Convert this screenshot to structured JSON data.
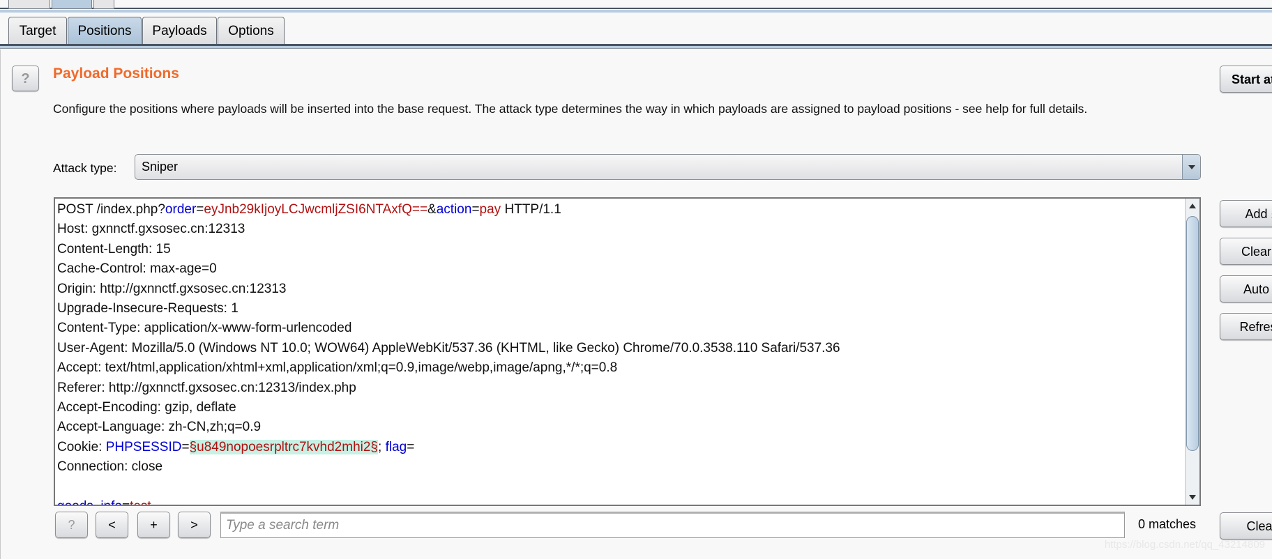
{
  "tabs": [
    {
      "label": "Target",
      "active": false
    },
    {
      "label": "Positions",
      "active": true
    },
    {
      "label": "Payloads",
      "active": false
    },
    {
      "label": "Options",
      "active": false
    }
  ],
  "section": {
    "help_label": "?",
    "title": "Payload Positions",
    "description": "Configure the positions where payloads will be inserted into the base request. The attack type determines the way in which payloads are assigned to payload positions - see help for full details."
  },
  "attack_type": {
    "label": "Attack type:",
    "value": "Sniper"
  },
  "request_lines": [
    [
      {
        "t": "plain",
        "s": "POST /index.php?"
      },
      {
        "t": "name",
        "s": "order"
      },
      {
        "t": "plain",
        "s": "="
      },
      {
        "t": "value",
        "s": "eyJnb29kIjoyLCJwcmljZSI6NTAxfQ=="
      },
      {
        "t": "plain",
        "s": "&"
      },
      {
        "t": "name",
        "s": "action"
      },
      {
        "t": "plain",
        "s": "="
      },
      {
        "t": "value",
        "s": "pay"
      },
      {
        "t": "plain",
        "s": " HTTP/1.1"
      }
    ],
    [
      {
        "t": "plain",
        "s": "Host: gxnnctf.gxsosec.cn:12313"
      }
    ],
    [
      {
        "t": "plain",
        "s": "Content-Length: 15"
      }
    ],
    [
      {
        "t": "plain",
        "s": "Cache-Control: max-age=0"
      }
    ],
    [
      {
        "t": "plain",
        "s": "Origin: http://gxnnctf.gxsosec.cn:12313"
      }
    ],
    [
      {
        "t": "plain",
        "s": "Upgrade-Insecure-Requests: 1"
      }
    ],
    [
      {
        "t": "plain",
        "s": "Content-Type: application/x-www-form-urlencoded"
      }
    ],
    [
      {
        "t": "plain",
        "s": "User-Agent: Mozilla/5.0 (Windows NT 10.0; WOW64) AppleWebKit/537.36 (KHTML, like Gecko) Chrome/70.0.3538.110 Safari/537.36"
      }
    ],
    [
      {
        "t": "plain",
        "s": "Accept: text/html,application/xhtml+xml,application/xml;q=0.9,image/webp,image/apng,*/*;q=0.8"
      }
    ],
    [
      {
        "t": "plain",
        "s": "Referer: http://gxnnctf.gxsosec.cn:12313/index.php"
      }
    ],
    [
      {
        "t": "plain",
        "s": "Accept-Encoding: gzip, deflate"
      }
    ],
    [
      {
        "t": "plain",
        "s": "Accept-Language: zh-CN,zh;q=0.9"
      }
    ],
    [
      {
        "t": "plain",
        "s": "Cookie: "
      },
      {
        "t": "name",
        "s": "PHPSESSID"
      },
      {
        "t": "plain",
        "s": "="
      },
      {
        "t": "marker",
        "s": "§u849nopoesrpltrc7kvhd2mhi2§"
      },
      {
        "t": "plain",
        "s": "; "
      },
      {
        "t": "name",
        "s": "flag"
      },
      {
        "t": "plain",
        "s": "="
      }
    ],
    [
      {
        "t": "plain",
        "s": "Connection: close"
      }
    ],
    [
      {
        "t": "plain",
        "s": ""
      }
    ],
    [
      {
        "t": "name",
        "s": "goods_info"
      },
      {
        "t": "plain",
        "s": "="
      },
      {
        "t": "value",
        "s": "test"
      }
    ]
  ],
  "search_bar": {
    "help_label": "?",
    "prev_label": "<",
    "add_label": "+",
    "next_label": ">",
    "placeholder": "Type a search term",
    "value": "",
    "matches": "0 matches"
  },
  "side_buttons": {
    "start_attack": "Start attack",
    "add": "Add §",
    "clear": "Clear §",
    "auto": "Auto §",
    "refresh": "Refresh",
    "clear_search": "Clear"
  },
  "watermark": "https://blog.csdn.net/qq_43214809",
  "colors": {
    "title": "#f06a2a",
    "param_name": "#0000d6",
    "param_value": "#b01010",
    "marker_bg": "#c6f1e4",
    "active_tab": "#b9cde0"
  }
}
